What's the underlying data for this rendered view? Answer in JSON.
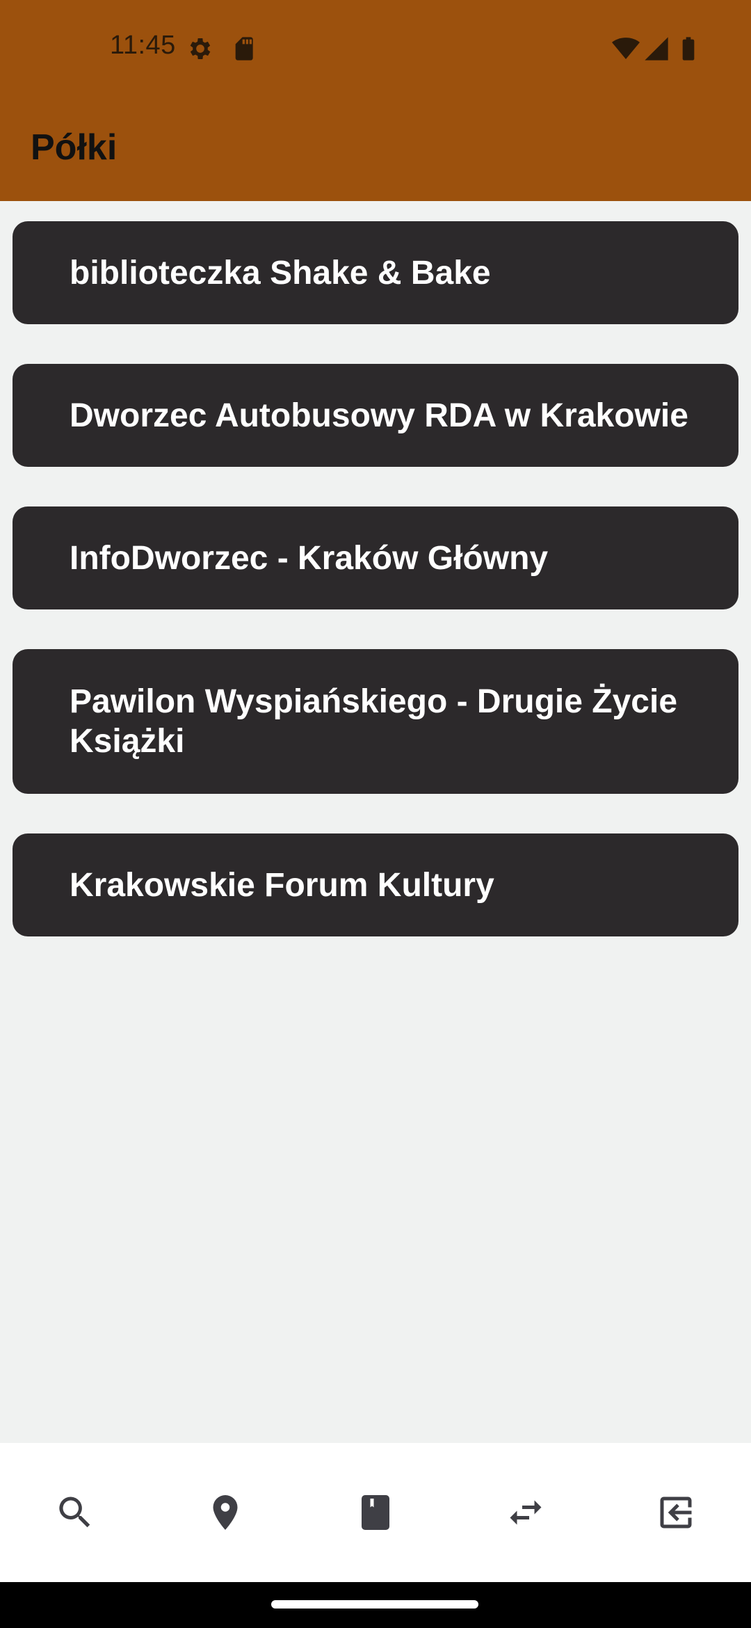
{
  "status_bar": {
    "time": "11:45",
    "icons": [
      "settings-gear-icon",
      "sd-card-icon",
      "wifi-icon",
      "signal-icon",
      "battery-icon"
    ]
  },
  "app_bar": {
    "title": "Półki",
    "color": "#9c510d"
  },
  "shelves": [
    {
      "label": "biblioteczka Shake & Bake"
    },
    {
      "label": "Dworzec Autobusowy RDA w Krakowie"
    },
    {
      "label": "InfoDworzec - Kraków Główny"
    },
    {
      "label": "Pawilon Wyspiańskiego - Drugie Życie Książki"
    },
    {
      "label": "Krakowskie Forum Kultury"
    }
  ],
  "bottom_nav": {
    "items": [
      {
        "icon": "search-icon"
      },
      {
        "icon": "location-pin-icon"
      },
      {
        "icon": "book-icon"
      },
      {
        "icon": "swap-arrows-icon"
      },
      {
        "icon": "logout-icon"
      }
    ]
  },
  "colors": {
    "card_background": "#2c292b",
    "page_background": "#f0f2f1",
    "nav_icon": "#3f3f45"
  }
}
